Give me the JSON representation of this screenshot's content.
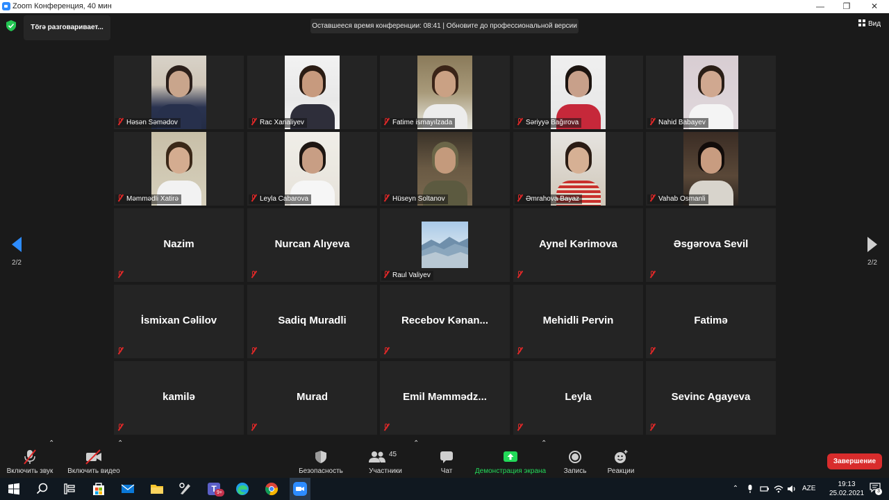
{
  "window": {
    "title": "Zoom Конференция, 40 мин",
    "minimize": "—",
    "maximize": "❐",
    "close": "✕"
  },
  "talking": "Törə разговаривает...",
  "timer": "Оставшееся время конференции: 08:41 | Обновите до профессиональной версии",
  "view": {
    "label": "Вид"
  },
  "pagination": {
    "left": "2/2",
    "right": "2/2"
  },
  "participants": [
    {
      "name": "Həsən Səmədov",
      "video": true,
      "scene": "woman"
    },
    {
      "name": "Rac Xanaliyev",
      "video": true,
      "scene": "boy"
    },
    {
      "name": "Fatime ismayılzada",
      "video": true,
      "scene": "girl"
    },
    {
      "name": "Səriyyə Bağırova",
      "video": true,
      "scene": "girl-red"
    },
    {
      "name": "Nahid Babayev",
      "video": true,
      "scene": "boy-white"
    },
    {
      "name": "Məmmədli Xatirə",
      "video": true,
      "scene": "girl-white"
    },
    {
      "name": "Leyla Cabarova",
      "video": true,
      "scene": "girl-print"
    },
    {
      "name": "Hüseyn Soltanov",
      "video": true,
      "scene": "soldier"
    },
    {
      "name": "Əmrahova Bayaz",
      "video": true,
      "scene": "girl-stripes"
    },
    {
      "name": "Vahab Osmanli",
      "video": true,
      "scene": "girl-dark"
    },
    {
      "name": "Nazim",
      "video": false
    },
    {
      "name": "Nurcan Alıyeva",
      "video": false
    },
    {
      "name": "Raul Valiyev",
      "video": false,
      "thumbnail": "mountains"
    },
    {
      "name": "Aynel Kərimova",
      "video": false
    },
    {
      "name": "Əsgərova Sevil",
      "video": false
    },
    {
      "name": "İsmixan Cəlilov",
      "video": false
    },
    {
      "name": "Sadiq Muradli",
      "video": false
    },
    {
      "name": "Recebov  Kənan...",
      "video": false
    },
    {
      "name": "Mehidli Pervin",
      "video": false
    },
    {
      "name": "Fatimə",
      "video": false
    },
    {
      "name": "kamilə",
      "video": false
    },
    {
      "name": "Murad",
      "video": false
    },
    {
      "name": "Emil  Məmmədz...",
      "video": false
    },
    {
      "name": "Leyla",
      "video": false
    },
    {
      "name": "Sevinc Agayeva",
      "video": false
    }
  ],
  "toolbar": {
    "audio": "Включить звук",
    "video": "Включить видео",
    "security": "Безопасность",
    "participants": "Участники",
    "participants_count": "45",
    "chat": "Чат",
    "share": "Демонстрация экрана",
    "record": "Запись",
    "reactions": "Реакции",
    "end": "Завершение",
    "share_color": "#23d959"
  },
  "taskbar": {
    "lang": "AZE",
    "time": "19:13",
    "date": "25.02.2021",
    "notifications": "3",
    "teams_badge": "9+"
  }
}
